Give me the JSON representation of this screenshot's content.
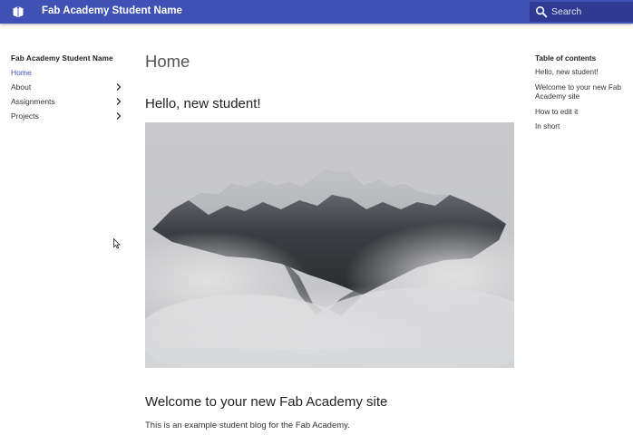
{
  "header": {
    "title": "Fab Academy Student Name",
    "search_placeholder": "Search",
    "colors": {
      "bar": "#3f51b5",
      "search_bg": "#2f3b92"
    },
    "logo_icon": "book-icon",
    "search_icon": "search-icon"
  },
  "nav": {
    "title": "Fab Academy Student Name",
    "items": [
      {
        "label": "Home",
        "active": true
      },
      {
        "label": "About",
        "expandable": true
      },
      {
        "label": "Assignments",
        "expandable": true
      },
      {
        "label": "Projects",
        "expandable": true
      }
    ]
  },
  "main": {
    "page_title": "Home",
    "section1_heading": "Hello, new student!",
    "hero_image": "misty mountain peak photo",
    "section2_heading": "Welcome to your new Fab Academy site",
    "section2_text": "This is an example student blog for the Fab Academy."
  },
  "toc": {
    "title": "Table of contents",
    "items": [
      "Hello, new student!",
      "Welcome to your new Fab Academy site",
      "How to edit it",
      "In short"
    ]
  }
}
